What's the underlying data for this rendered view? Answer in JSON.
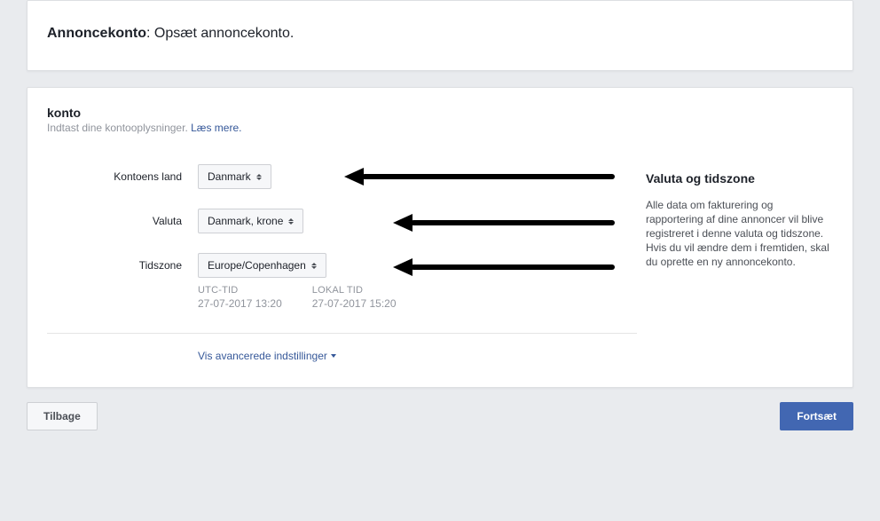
{
  "header": {
    "title_bold": "Annoncekonto",
    "title_rest": ": Opsæt annoncekonto."
  },
  "section": {
    "title": "konto",
    "subtitle": "Indtast dine kontooplysninger.",
    "learn_more": "Læs mere."
  },
  "form": {
    "country": {
      "label": "Kontoens land",
      "value": "Danmark"
    },
    "currency": {
      "label": "Valuta",
      "value": "Danmark, krone"
    },
    "timezone": {
      "label": "Tidszone",
      "value": "Europe/Copenhagen"
    },
    "utc": {
      "label": "UTC-TID",
      "value": "27-07-2017 13:20"
    },
    "local": {
      "label": "LOKAL TID",
      "value": "27-07-2017 15:20"
    },
    "advanced": "Vis avancerede indstillinger"
  },
  "side": {
    "title": "Valuta og tidszone",
    "text": "Alle data om fakturering og rapportering af dine annoncer vil blive registreret i denne valuta og tidszone. Hvis du vil ændre dem i fremtiden, skal du oprette en ny annoncekonto."
  },
  "footer": {
    "back": "Tilbage",
    "continue": "Fortsæt"
  }
}
